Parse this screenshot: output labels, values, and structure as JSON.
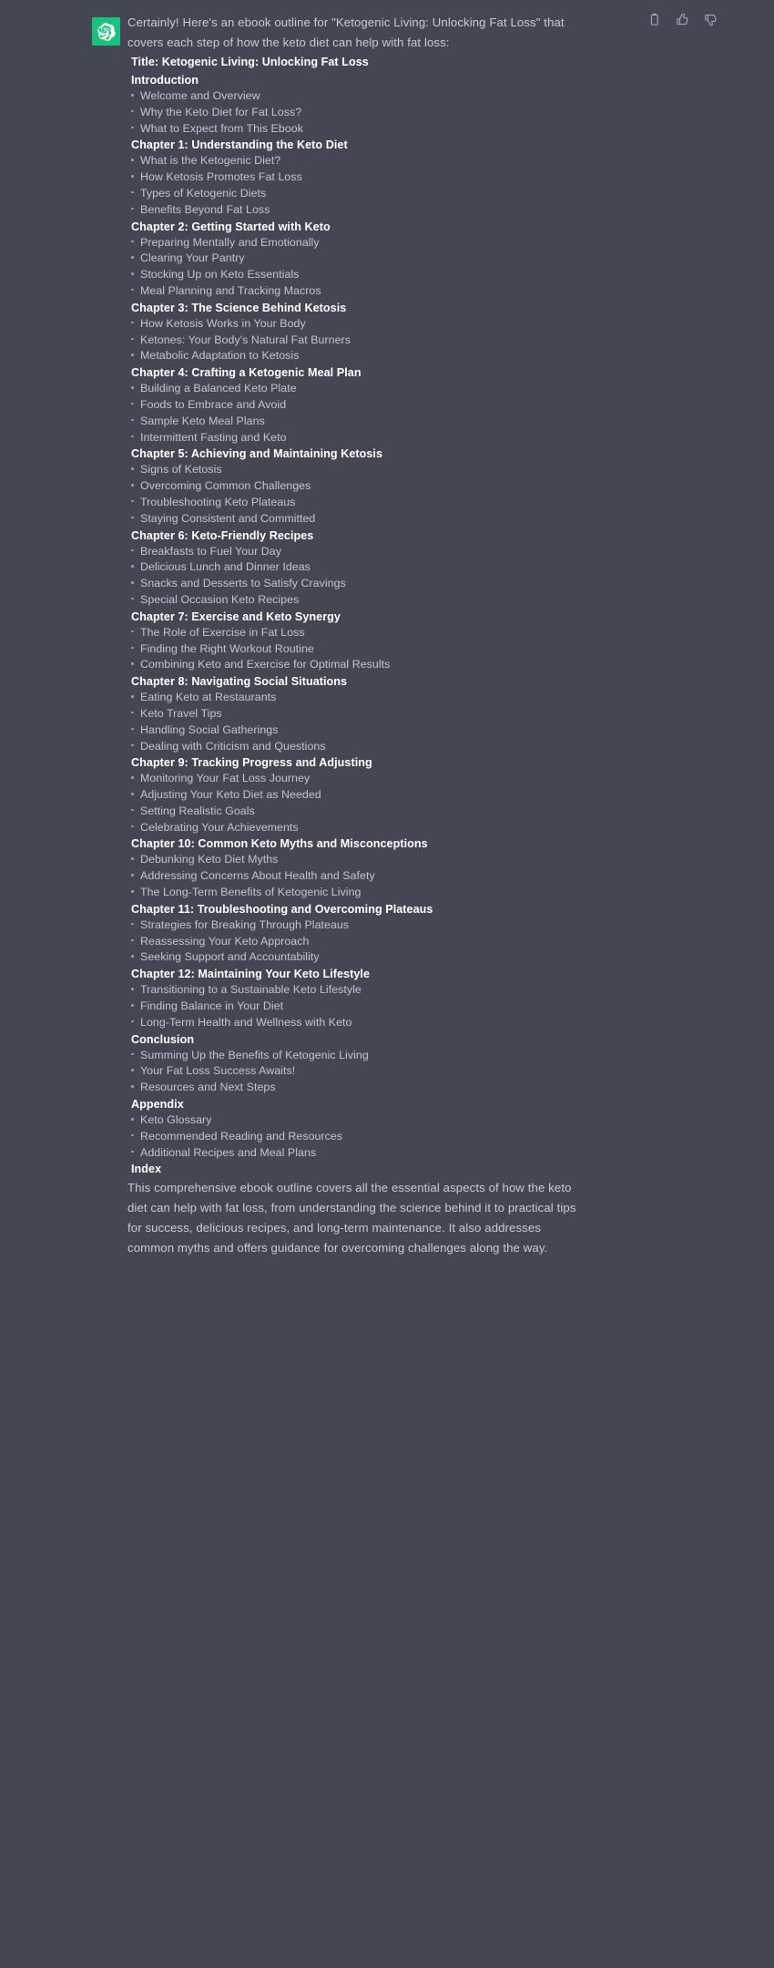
{
  "theme": {
    "background": "#444654",
    "text_primary": "#ffffff",
    "text_body": "#c9cbd6",
    "text_bullet": "#c2c5d2",
    "avatar_background": "#19c37d"
  },
  "avatar": {
    "icon": "openai-logo-icon",
    "alt": "ChatGPT"
  },
  "actions": [
    {
      "name": "copy-icon",
      "label": "Copy"
    },
    {
      "name": "thumbs-up-icon",
      "label": "Good response"
    },
    {
      "name": "thumbs-down-icon",
      "label": "Bad response"
    }
  ],
  "message": {
    "intro": "Certainly! Here's an ebook outline for \"Ketogenic Living: Unlocking Fat Loss\" that covers each step of how the keto diet can help with fat loss:",
    "title": "Title: Ketogenic Living: Unlocking Fat Loss",
    "sections": [
      {
        "heading": "Introduction",
        "items": [
          "Welcome and Overview",
          "Why the Keto Diet for Fat Loss?",
          "What to Expect from This Ebook"
        ]
      },
      {
        "heading": "Chapter 1: Understanding the Keto Diet",
        "items": [
          "What is the Ketogenic Diet?",
          "How Ketosis Promotes Fat Loss",
          "Types of Ketogenic Diets",
          "Benefits Beyond Fat Loss"
        ]
      },
      {
        "heading": "Chapter 2: Getting Started with Keto",
        "items": [
          "Preparing Mentally and Emotionally",
          "Clearing Your Pantry",
          "Stocking Up on Keto Essentials",
          "Meal Planning and Tracking Macros"
        ]
      },
      {
        "heading": "Chapter 3: The Science Behind Ketosis",
        "items": [
          "How Ketosis Works in Your Body",
          "Ketones: Your Body's Natural Fat Burners",
          "Metabolic Adaptation to Ketosis"
        ]
      },
      {
        "heading": "Chapter 4: Crafting a Ketogenic Meal Plan",
        "items": [
          "Building a Balanced Keto Plate",
          "Foods to Embrace and Avoid",
          "Sample Keto Meal Plans",
          "Intermittent Fasting and Keto"
        ]
      },
      {
        "heading": "Chapter 5: Achieving and Maintaining Ketosis",
        "items": [
          "Signs of Ketosis",
          "Overcoming Common Challenges",
          "Troubleshooting Keto Plateaus",
          "Staying Consistent and Committed"
        ]
      },
      {
        "heading": "Chapter 6: Keto-Friendly Recipes",
        "items": [
          "Breakfasts to Fuel Your Day",
          "Delicious Lunch and Dinner Ideas",
          "Snacks and Desserts to Satisfy Cravings",
          "Special Occasion Keto Recipes"
        ]
      },
      {
        "heading": "Chapter 7: Exercise and Keto Synergy",
        "items": [
          "The Role of Exercise in Fat Loss",
          "Finding the Right Workout Routine",
          "Combining Keto and Exercise for Optimal Results"
        ]
      },
      {
        "heading": "Chapter 8: Navigating Social Situations",
        "items": [
          "Eating Keto at Restaurants",
          "Keto Travel Tips",
          "Handling Social Gatherings",
          "Dealing with Criticism and Questions"
        ]
      },
      {
        "heading": "Chapter 9: Tracking Progress and Adjusting",
        "items": [
          "Monitoring Your Fat Loss Journey",
          "Adjusting Your Keto Diet as Needed",
          "Setting Realistic Goals",
          "Celebrating Your Achievements"
        ]
      },
      {
        "heading": "Chapter 10: Common Keto Myths and Misconceptions",
        "items": [
          "Debunking Keto Diet Myths",
          "Addressing Concerns About Health and Safety",
          "The Long-Term Benefits of Ketogenic Living"
        ]
      },
      {
        "heading": "Chapter 11: Troubleshooting and Overcoming Plateaus",
        "items": [
          "Strategies for Breaking Through Plateaus",
          "Reassessing Your Keto Approach",
          "Seeking Support and Accountability"
        ]
      },
      {
        "heading": "Chapter 12: Maintaining Your Keto Lifestyle",
        "items": [
          "Transitioning to a Sustainable Keto Lifestyle",
          "Finding Balance in Your Diet",
          "Long-Term Health and Wellness with Keto"
        ]
      },
      {
        "heading": "Conclusion",
        "items": [
          "Summing Up the Benefits of Ketogenic Living",
          "Your Fat Loss Success Awaits!",
          "Resources and Next Steps"
        ]
      },
      {
        "heading": "Appendix",
        "items": [
          "Keto Glossary",
          "Recommended Reading and Resources",
          "Additional Recipes and Meal Plans"
        ]
      },
      {
        "heading": "Index",
        "items": []
      }
    ],
    "closing": "This comprehensive ebook outline covers all the essential aspects of how the keto diet can help with fat loss, from understanding the science behind it to practical tips for success, delicious recipes, and long-term maintenance. It also addresses common myths and offers guidance for overcoming challenges along the way."
  }
}
